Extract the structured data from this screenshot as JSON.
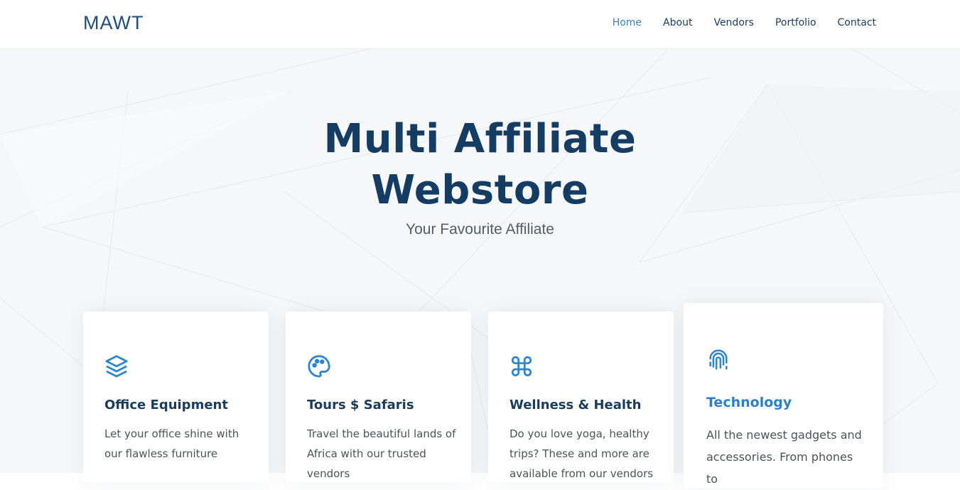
{
  "brand": {
    "logo": "MAWT"
  },
  "nav": {
    "items": [
      {
        "label": "Home",
        "active": true
      },
      {
        "label": "About",
        "active": false
      },
      {
        "label": "Vendors",
        "active": false
      },
      {
        "label": "Portfolio",
        "active": false
      },
      {
        "label": "Contact",
        "active": false
      }
    ]
  },
  "hero": {
    "title_line1": "Multi Affiliate",
    "title_line2": "Webstore",
    "subtitle": "Your Favourite Affiliate"
  },
  "cards": [
    {
      "icon": "layers-icon",
      "title": "Office Equipment",
      "text": "Let your office shine with our flawless furniture"
    },
    {
      "icon": "palette-icon",
      "title": "Tours $ Safaris",
      "text": "Travel the beautiful lands of Africa with our trusted vendors"
    },
    {
      "icon": "command-icon",
      "title": "Wellness & Health",
      "text": "Do you love yoga, healthy trips? These and more are available from our vendors"
    },
    {
      "icon": "fingerprint-icon",
      "title": "Technology",
      "text": "All the newest gadgets and accessories. From phones to"
    }
  ],
  "colors": {
    "accent": "#3f7fc1",
    "heading": "#153d63",
    "icon": "#2e86d1"
  }
}
